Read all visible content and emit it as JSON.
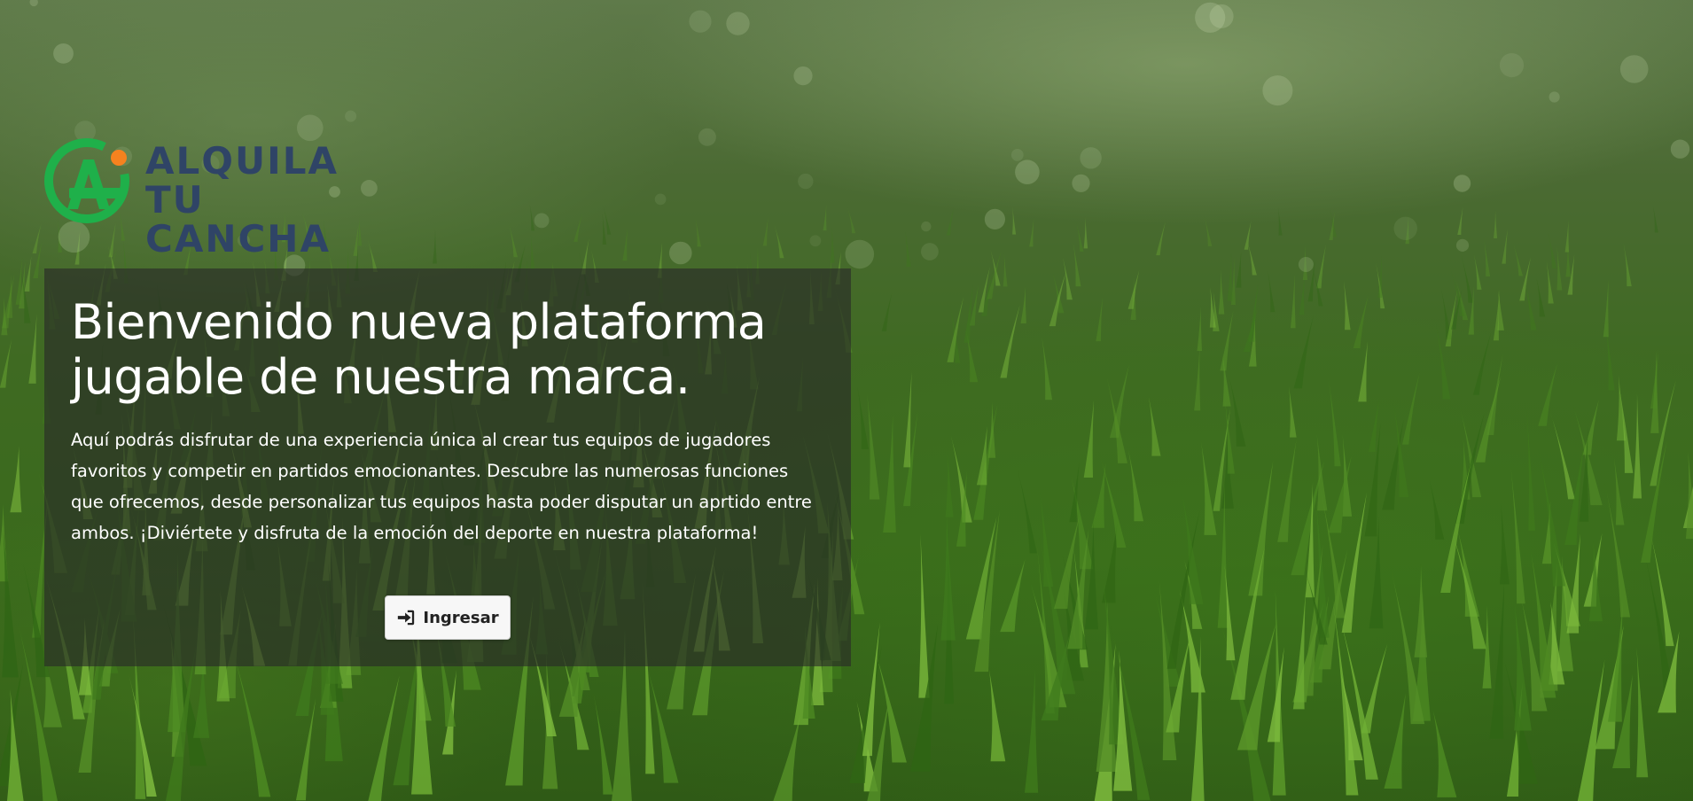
{
  "brand": {
    "line1": "ALQUILA",
    "line2": "TU CANCHA",
    "colors": {
      "green": "#1fb04a",
      "orange": "#f5821f",
      "navy": "#2f4466"
    }
  },
  "hero": {
    "title": "Bienvenido nueva plataforma jugable de nuestra marca.",
    "description": "Aquí podrás disfrutar de una experiencia única al crear tus equipos de jugadores favoritos y competir en partidos emocionantes. Descubre las numerosas funciones que ofrecemos, desde personalizar tus equipos hasta poder disputar un aprtido entre ambos. ¡Diviértete y disfruta de la emoción del deporte en nuestra plataforma!",
    "cta_label": "Ingresar",
    "cta_icon": "sign-in-icon"
  },
  "background": {
    "subject": "grass-field",
    "overlay_color": "#282828"
  }
}
